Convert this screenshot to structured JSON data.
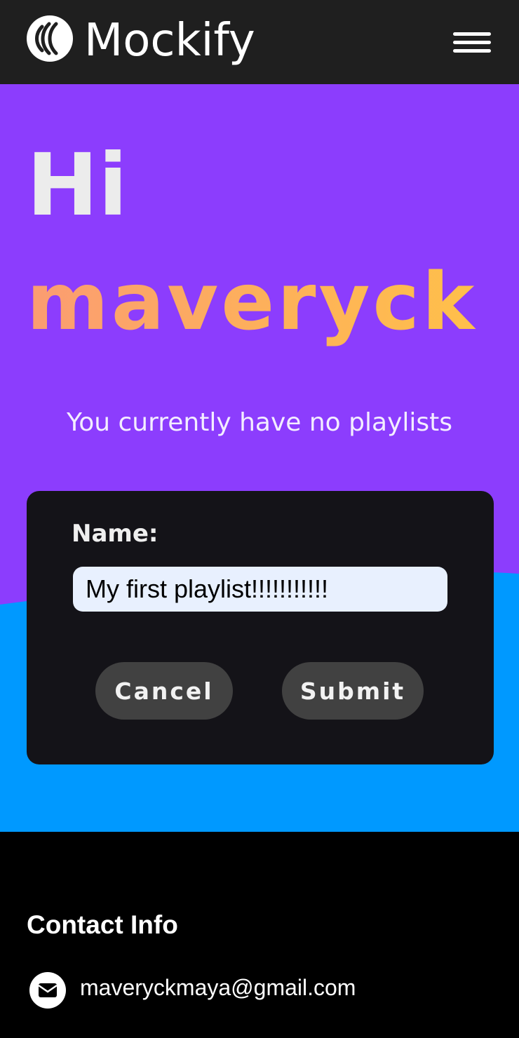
{
  "header": {
    "brand": "Mockify",
    "logo_icon": "sound-waves-icon",
    "menu_icon": "hamburger-menu-icon"
  },
  "hero": {
    "greeting": "Hi",
    "username": "maveryck",
    "subtitle": "You currently have no playlists"
  },
  "form": {
    "name_label": "Name:",
    "name_value": "My first playlist!!!!!!!!!!!",
    "cancel_label": "Cancel",
    "submit_label": "Submit"
  },
  "footer": {
    "contact_title": "Contact Info",
    "email_icon": "email-icon",
    "email": "maveryckmaya@gmail.com"
  },
  "colors": {
    "header_bg": "#1f1f1f",
    "hero_purple": "#8c3dfd",
    "wave_blue": "#0099ff",
    "card_bg": "#141318",
    "button_bg": "#414141",
    "username_gradient_start": "#fb9c72",
    "username_gradient_end": "#ffc04a",
    "footer_bg": "#000000"
  }
}
